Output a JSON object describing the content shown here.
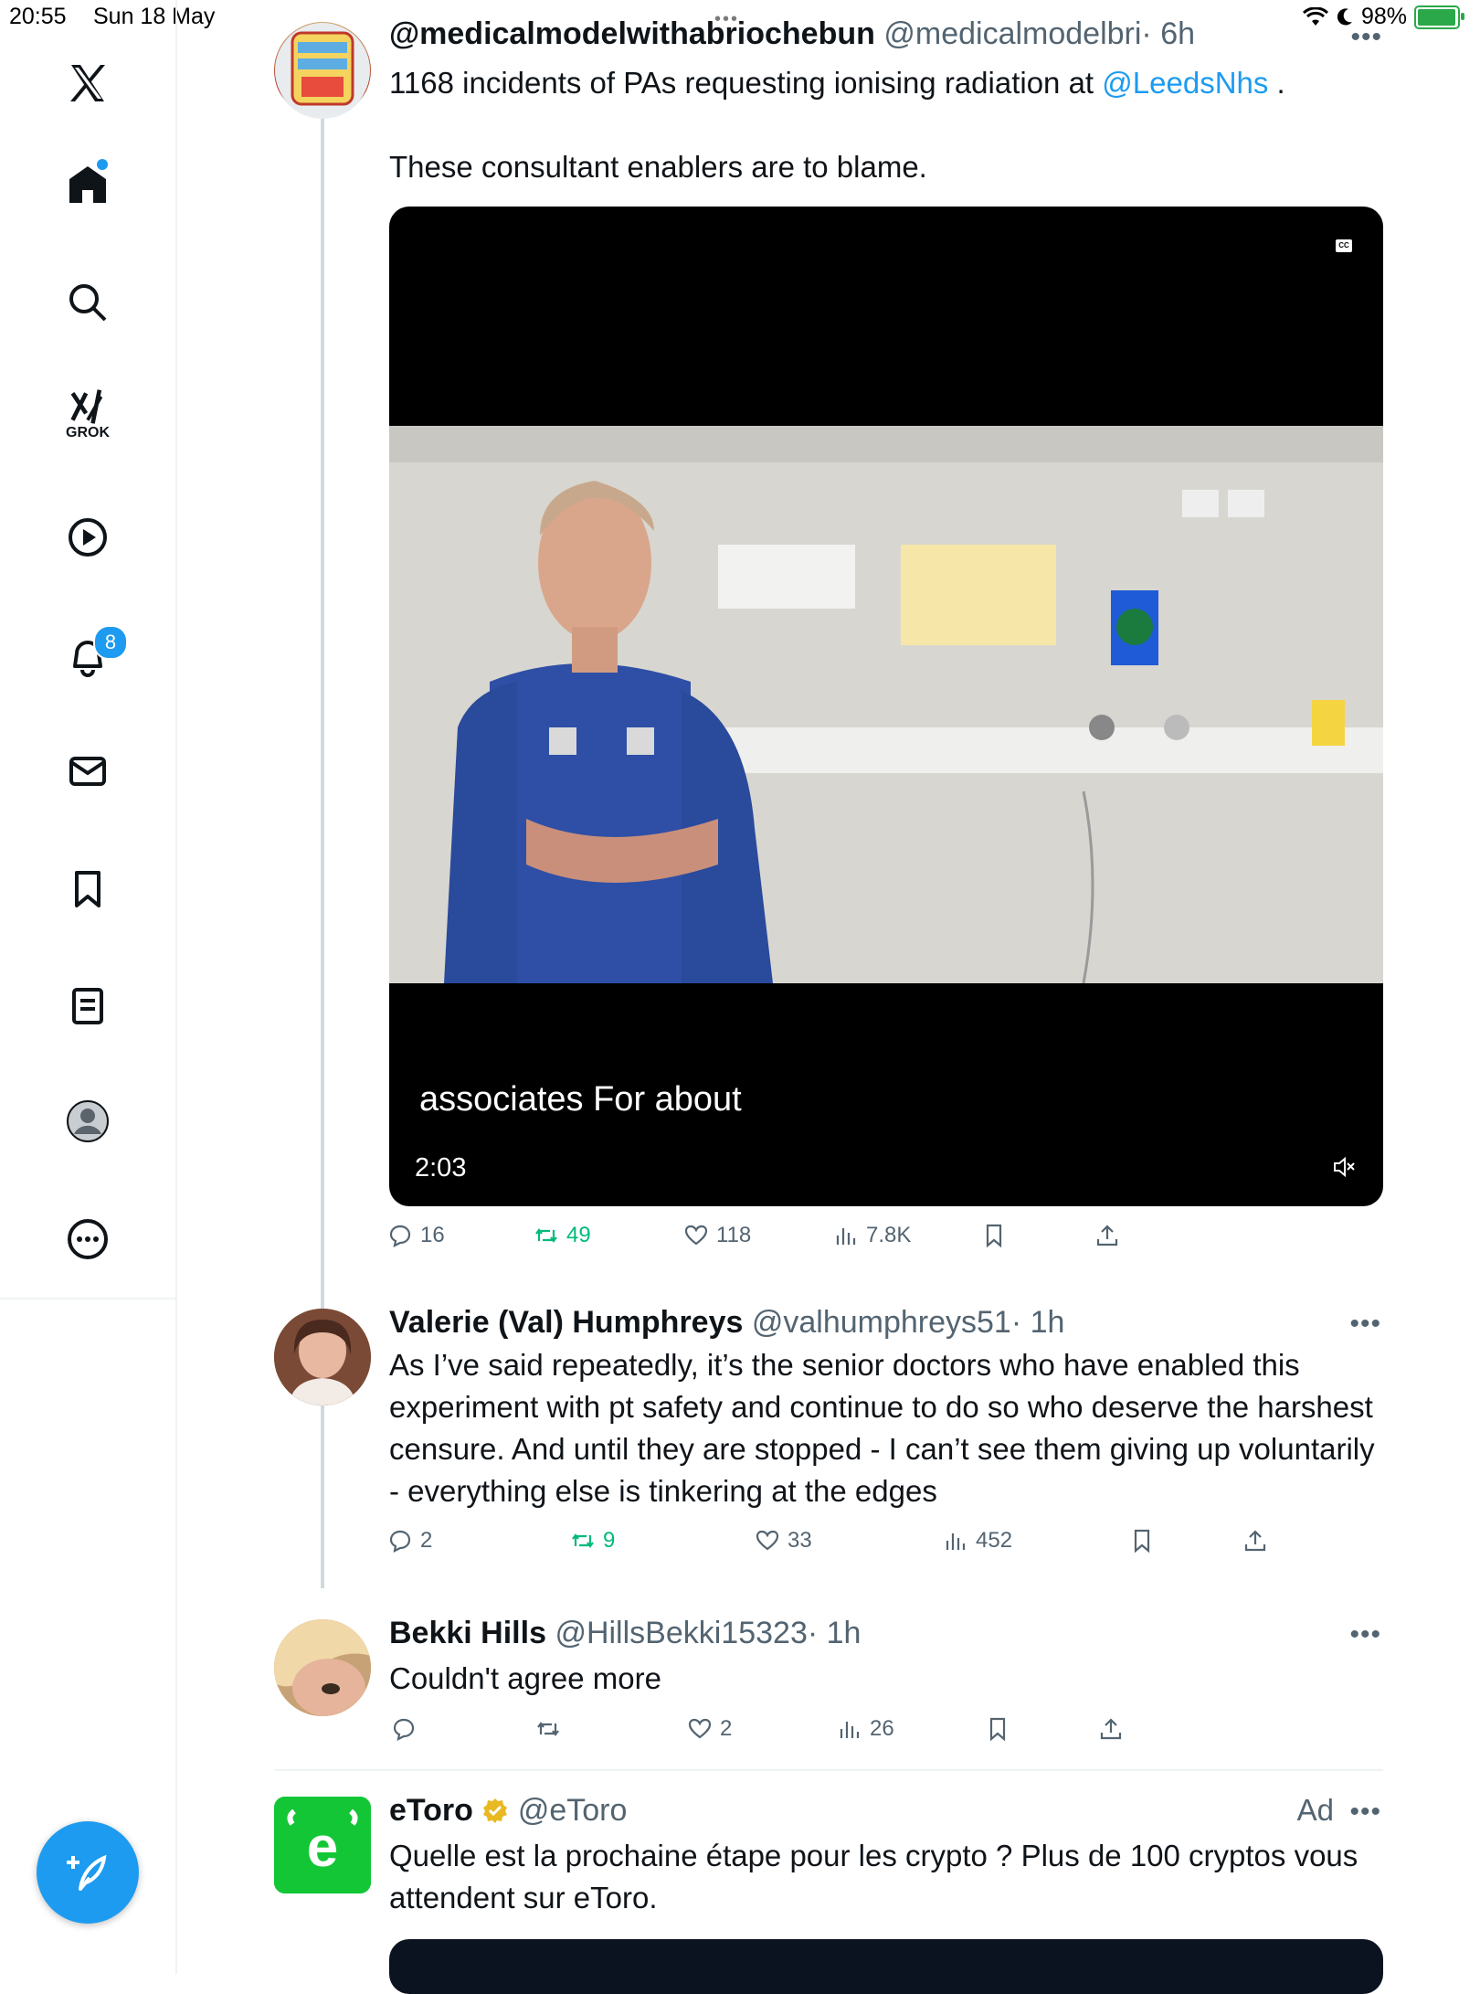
{
  "status_bar": {
    "time": "20:55",
    "date": "Sun 18 May",
    "battery_percent": "98%",
    "battery_level": 0.98
  },
  "sidebar": {
    "items": [
      {
        "name": "x-logo"
      },
      {
        "name": "home-icon"
      },
      {
        "name": "search-icon"
      },
      {
        "name": "grok-icon",
        "label": "GROK"
      },
      {
        "name": "video-icon"
      },
      {
        "name": "notifications-icon",
        "badge": "8"
      },
      {
        "name": "messages-icon"
      },
      {
        "name": "bookmarks-icon"
      },
      {
        "name": "lists-icon"
      },
      {
        "name": "profile-icon"
      },
      {
        "name": "more-icon"
      }
    ],
    "compose_icon": "compose-icon"
  },
  "tweets": [
    {
      "name": "@medicalmodelwithabriochebun",
      "handle": "@medicalmodelbri",
      "time": "· 6h",
      "text_line1_prefix": "1168 incidents of PAs requesting ionising radiation at ",
      "mention": "@LeedsNhs",
      "text_line1_suffix": " .",
      "text_line2": "These consultant enablers are to blame.",
      "video": {
        "caption": "associates For about",
        "duration": "2:03",
        "cc": "CC"
      },
      "replies": "16",
      "reposts": "49",
      "likes": "118",
      "views": "7.8K"
    },
    {
      "name": "Valerie (Val) Humphreys",
      "handle": "@valhumphreys51",
      "time": "· 1h",
      "text": "As I’ve said repeatedly, it’s the senior doctors who have enabled this experiment with pt safety and continue to do so who deserve the harshest censure. And until they are stopped - I can’t see them giving up voluntarily - everything else is tinkering at the edges",
      "replies": "2",
      "reposts": "9",
      "likes": "33",
      "views": "452"
    },
    {
      "name": "Bekki Hills",
      "handle": "@HillsBekki15323",
      "time": "· 1h",
      "text": "Couldn't agree more",
      "replies": "",
      "reposts": "",
      "likes": "2",
      "views": "26"
    },
    {
      "name": "eToro",
      "handle": "@eToro",
      "ad_label": "Ad",
      "text": "Quelle est la prochaine étape pour les crypto ? Plus de 100 cryptos vous attendent sur eToro."
    }
  ],
  "colors": {
    "accent": "#1d9bf0",
    "repost_green": "#00ba7c",
    "etoro_green": "#13c636"
  }
}
